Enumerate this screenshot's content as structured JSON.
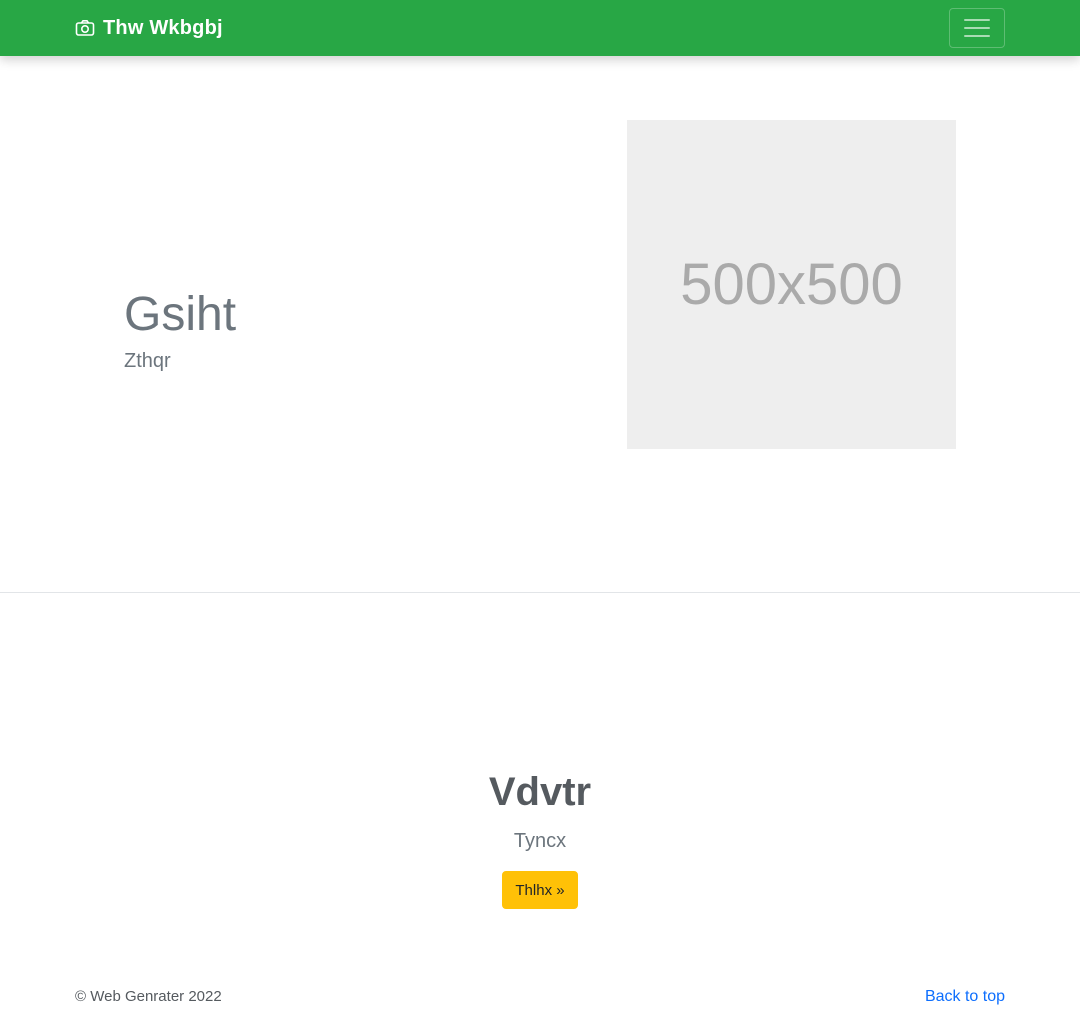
{
  "navbar": {
    "brand_icon": "camera-icon",
    "brand_text": "Thw Wkbgbj",
    "toggler_icon": "hamburger-menu-icon",
    "background_color": "#28a745"
  },
  "hero": {
    "title": "Gsiht",
    "subtitle": "Zthqr",
    "image_placeholder_text": "500x500"
  },
  "cta": {
    "title": "Vdvtr",
    "subtitle": "Tyncx",
    "button_label": "Thlhx »",
    "button_color": "#ffc107"
  },
  "footer": {
    "copyright": "© Web Genrater 2022",
    "back_to_top": "Back to top",
    "link_color": "#0d6efd"
  }
}
